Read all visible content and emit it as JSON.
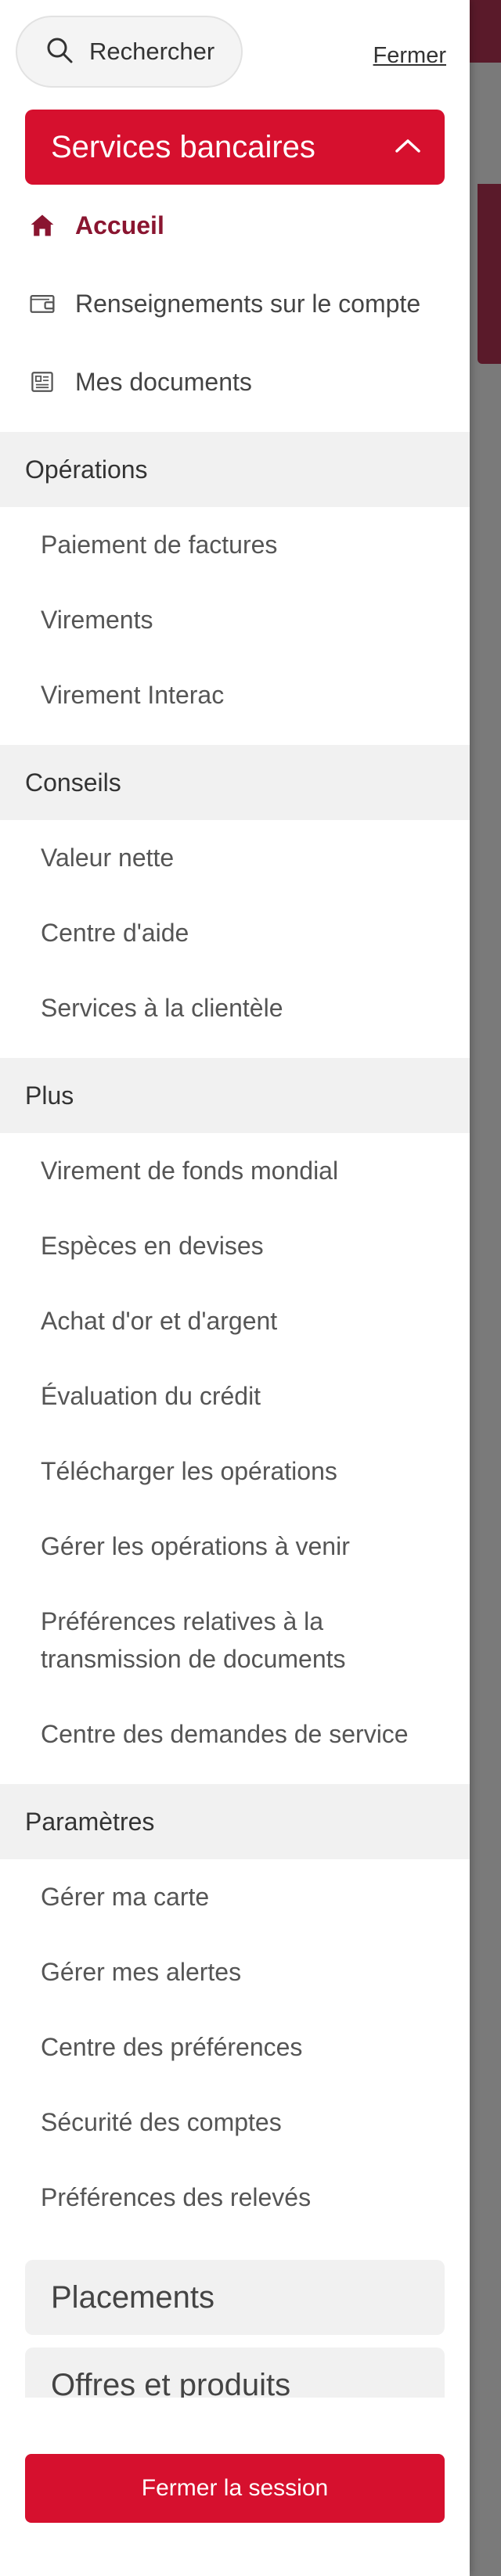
{
  "header": {
    "search_label": "Rechercher",
    "close_label": "Fermer"
  },
  "banking": {
    "title": "Services bancaires",
    "items": [
      {
        "label": "Accueil",
        "icon": "home-icon",
        "active": true
      },
      {
        "label": "Renseignements sur le compte",
        "icon": "wallet-icon"
      },
      {
        "label": "Mes documents",
        "icon": "document-icon"
      }
    ]
  },
  "sections": [
    {
      "title": "Opérations",
      "links": [
        "Paiement de factures",
        "Virements",
        "Virement Interac"
      ]
    },
    {
      "title": "Conseils",
      "links": [
        "Valeur nette",
        "Centre d'aide",
        "Services à la clientèle"
      ]
    },
    {
      "title": "Plus",
      "links": [
        "Virement de fonds mondial",
        "Espèces en devises",
        "Achat d'or et d'argent",
        "Évaluation du crédit",
        "Télécharger les opérations",
        "Gérer les opérations à venir",
        "Préférences relatives à la",
        "transmission de documents",
        "Centre des demandes de service"
      ]
    },
    {
      "title": "Paramètres",
      "links": [
        "Gérer ma carte",
        "Gérer mes alertes",
        "Centre des préférences",
        "Sécurité des comptes",
        "Préférences des relevés"
      ]
    }
  ],
  "collapsed_sections": [
    "Placements",
    "Offres et produits"
  ],
  "logout_label": "Fermer la session",
  "colors": {
    "brand_red": "#d6102e",
    "active_text": "#8a1530"
  }
}
